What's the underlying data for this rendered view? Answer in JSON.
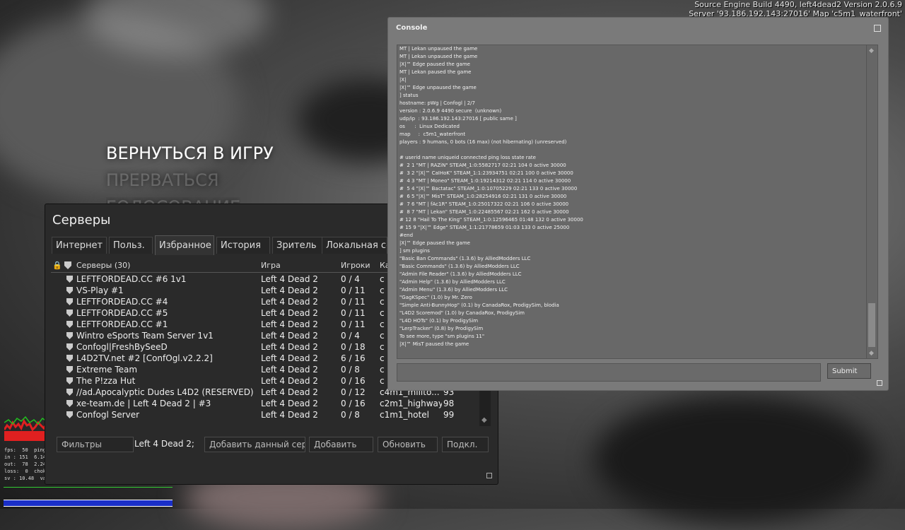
{
  "build_info": {
    "line1": "Source Engine Build 4490, left4dead2 Version 2.0.6.9",
    "line2": "Server '93.186.192.143:27016' Map 'c5m1_waterfront'"
  },
  "main_menu": {
    "items": [
      "ВЕРНУТЬСЯ В ИГРУ",
      "ПРЕРВАТЬСЯ",
      "ГОЛОСОВАНИЕ"
    ]
  },
  "servers": {
    "title": "Серверы",
    "tabs": [
      "Интернет",
      "Польз.",
      "Избранное",
      "История",
      "Зритель",
      "Локальная сеть"
    ],
    "active_tab": "Избранное",
    "columns": [
      "Серверы (30)",
      "Игра",
      "Игроки",
      "Карта"
    ],
    "rows": [
      {
        "name": "LEFTFORDEAD.CC #6 1v1",
        "game": "Left 4 Dead 2",
        "players": "0 / 4",
        "map": "c",
        "ping": ""
      },
      {
        "name": "VS-Play #1",
        "game": "Left 4 Dead 2",
        "players": "0 / 11",
        "map": "c",
        "ping": ""
      },
      {
        "name": "LEFTFORDEAD.CC #4",
        "game": "Left 4 Dead 2",
        "players": "0 / 11",
        "map": "c",
        "ping": ""
      },
      {
        "name": "LEFTFORDEAD.CC #5",
        "game": "Left 4 Dead 2",
        "players": "0 / 11",
        "map": "c",
        "ping": ""
      },
      {
        "name": "LEFTFORDEAD.CC #1",
        "game": "Left 4 Dead 2",
        "players": "0 / 11",
        "map": "c",
        "ping": ""
      },
      {
        "name": "Wintro eSports Team Server 1v1",
        "game": "Left 4 Dead 2",
        "players": "0 / 4",
        "map": "c",
        "ping": ""
      },
      {
        "name": "Confogl|FreshBySeeD",
        "game": "Left 4 Dead 2",
        "players": "0 / 18",
        "map": "c",
        "ping": ""
      },
      {
        "name": "L4D2TV.net #2 [ConfOgl.v2.2.2]",
        "game": "Left 4 Dead 2",
        "players": "6 / 16",
        "map": "c",
        "ping": ""
      },
      {
        "name": "Extreme Team",
        "game": "Left 4 Dead 2",
        "players": "0 / 8",
        "map": "c",
        "ping": ""
      },
      {
        "name": "The P!zza Hut",
        "game": "Left 4 Dead 2",
        "players": "0 / 16",
        "map": "c",
        "ping": ""
      },
      {
        "name": "//ad.Apocalyptic Dudes L4D2 (RESERVED)",
        "game": "Left 4 Dead 2",
        "players": "0 / 12",
        "map": "c4m1_millto...",
        "ping": "93"
      },
      {
        "name": "xe-team.de | Left 4 Dead 2 | #3",
        "game": "Left 4 Dead 2",
        "players": "0 / 16",
        "map": "c2m1_highway",
        "ping": "98"
      },
      {
        "name": "Confogl Server",
        "game": "Left 4 Dead 2",
        "players": "0 / 8",
        "map": "c1m1_hotel",
        "ping": "99"
      }
    ],
    "bottom": {
      "filters_label": "Фильтры",
      "filter_game": "Left 4 Dead 2;",
      "add_current_label": "Добавить данный сер...",
      "add_label": "Добавить",
      "refresh_label": "Обновить",
      "connect_label": "Подкл."
    }
  },
  "console": {
    "title": "Console",
    "submit_label": "Submit",
    "input_value": "",
    "lines": [
      "MT | Lekan unpaused the game",
      "MT | Lekan unpaused the game",
      "|X|™ Edge paused the game",
      "MT | Lekan paused the game",
      "|X|",
      "|X|™ Edge unpaused the game",
      "] status",
      "hostname: pWg | Confogl | 2/7",
      "version : 2.0.6.9 4490 secure  (unknown)",
      "udp/ip  : 93.186.192.143:27016 [ public same ]",
      "os      :  Linux Dedicated",
      "map     :  c5m1_waterfront",
      "players : 9 humans, 0 bots (16 max) (not hibernating) (unreserved)",
      "",
      "# userid name uniqueid connected ping loss state rate",
      "#  2 1 \"MT | RAZiN\" STEAM_1:0:5582717 02:21 104 0 active 30000",
      "#  3 2 \"|X|™ CaIHoK\" STEAM_1:1:23934751 02:21 100 0 active 30000",
      "#  4 3 \"MT | Moneo\" STEAM_1:0:19214312 02:21 114 0 active 30000",
      "#  5 4 \"|X|™ Bactatac\" STEAM_1:0:10705229 02:21 133 0 active 30000",
      "#  6 5 \"|X|™ MisT\" STEAM_1:0:28254916 02:21 131 0 active 30000",
      "#  7 6 \"MT | fAc1R\" STEAM_1:0:25017322 02:21 106 0 active 30000",
      "#  8 7 \"MT | Lekan\" STEAM_1:0:22485567 02:21 162 0 active 30000",
      "# 12 8 \"Hail To The King\" STEAM_1:0:12596465 01:48 132 0 active 30000",
      "# 15 9 \"|X|™ Edge\" STEAM_1:1:21778659 01:03 133 0 active 25000",
      "#end",
      "|X|™ Edge paused the game",
      "] sm plugins",
      "\"Basic Ban Commands\" (1.3.6) by AlliedModders LLC",
      "\"Basic Commands\" (1.3.6) by AlliedModders LLC",
      "\"Admin File Reader\" (1.3.6) by AlliedModders LLC",
      "\"Admin Help\" (1.3.6) by AlliedModders LLC",
      "\"Admin Menu\" (1.3.6) by AlliedModders LLC",
      "\"GagKSpec\" (1.0) by Mr. Zero",
      "\"Simple Anti-BunnyHop\" (0.1) by CanadaRox, ProdigySim, blodia",
      "\"L4D2 Scoremod\" (1.0) by CanadaRox, ProdigySim",
      "\"L4D HOTs\" (0.1) by ProdigySim",
      "\"LerpTracker\" (0.8) by ProdigySim",
      "To see more, type \"sm plugins 11\"",
      "|X|™ MisT paused the game"
    ]
  },
  "net_graph": {
    "lines": [
      "fps:  50  ping:",
      "in : 151  6.14 k/s",
      "out:  78  2.24 k/s",
      "loss:  0  choke:",
      "sv : 10.48  var: 1.27 msec"
    ]
  },
  "colors": {
    "accent_blue": "#1a2fc8",
    "graph_red": "#e02020",
    "graph_green": "#20c020"
  }
}
